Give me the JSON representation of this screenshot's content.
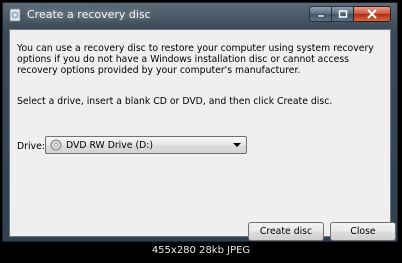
{
  "window": {
    "title": "Create a recovery disc",
    "icon": "recovery-disc-app-icon",
    "caption_buttons": [
      "minimize-icon",
      "maximize-icon",
      "close-icon"
    ]
  },
  "content": {
    "description": "You can use a recovery disc to restore your computer using system recovery options if you do not have a Windows installation disc or cannot access recovery options provided by your computer's manufacturer.",
    "instruction": "Select a drive, insert a blank CD or DVD, and then click Create disc.",
    "drive_label": "Drive:",
    "drive_selected": "DVD RW Drive (D:)",
    "drive_icon": "dvd-drive-icon"
  },
  "buttons": {
    "create": "Create disc",
    "close": "Close"
  },
  "footer": {
    "caption": "455x280 28kb JPEG"
  }
}
